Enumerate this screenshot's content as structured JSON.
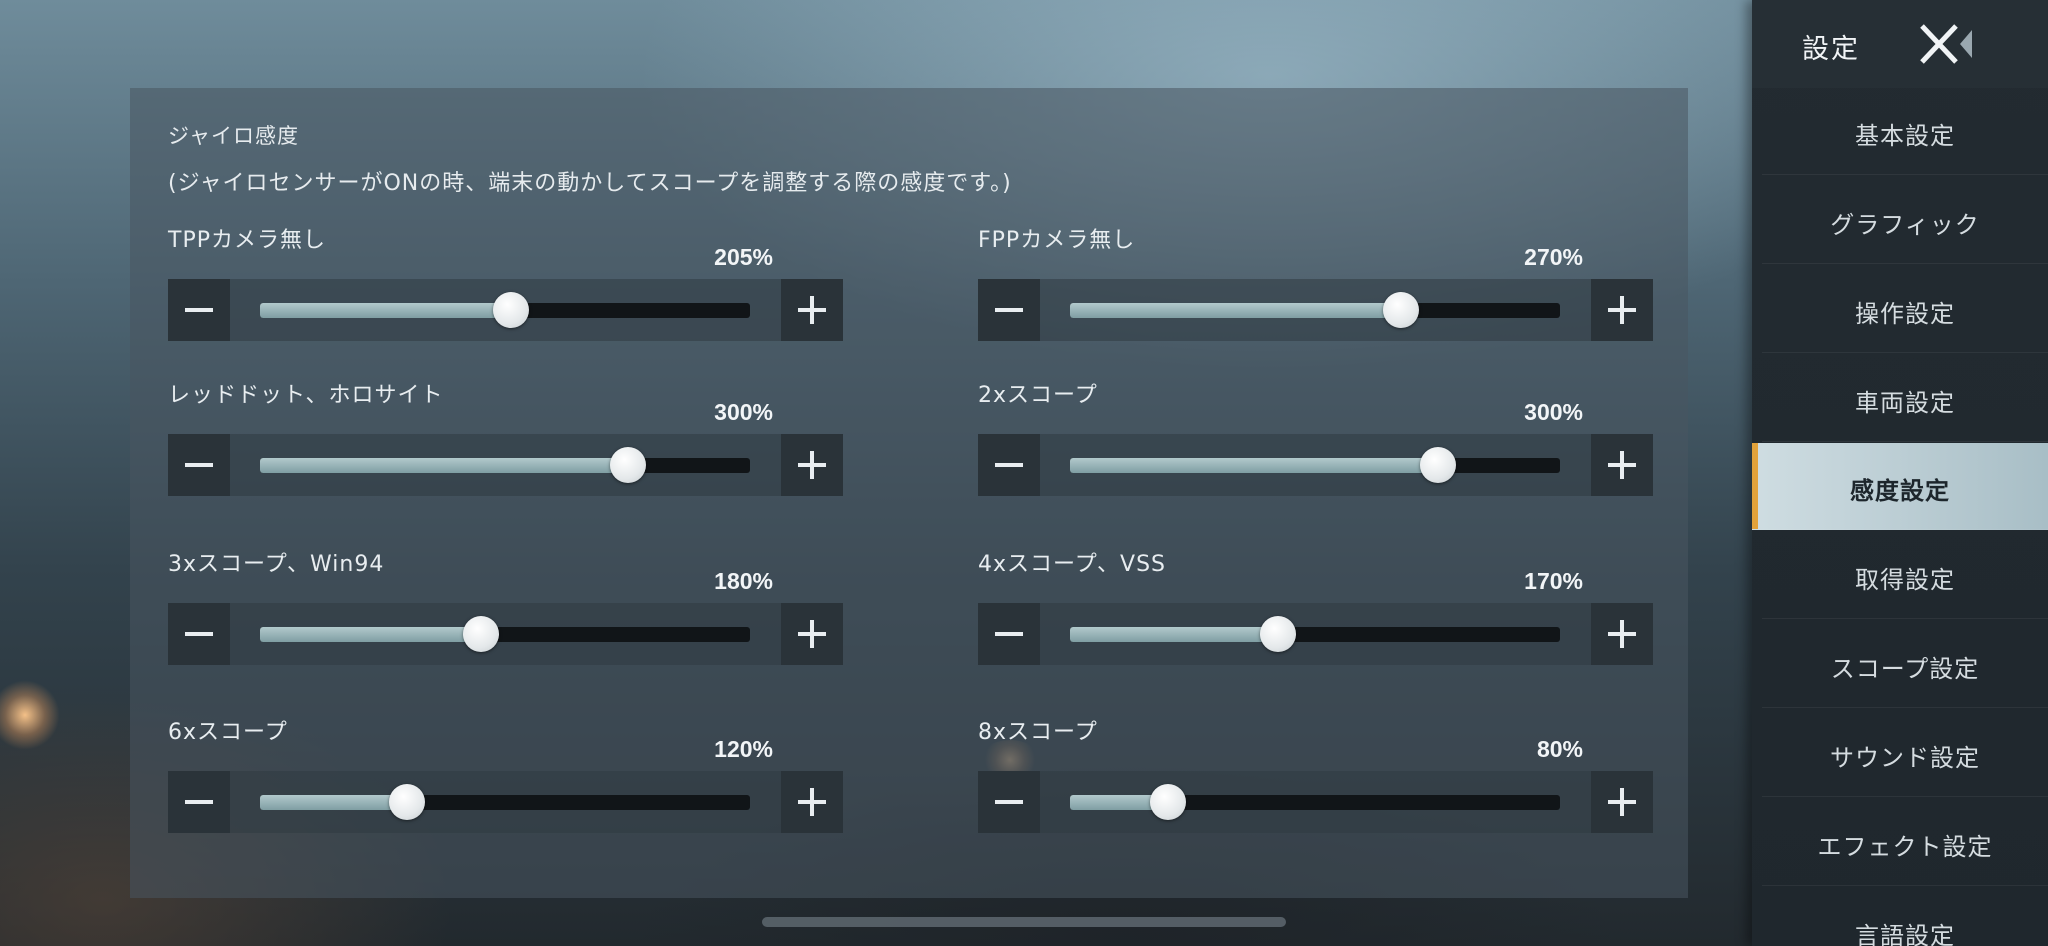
{
  "section": {
    "title": "ジャイロ感度",
    "description": "(ジャイロセンサーがONの時、端末の動かしてスコープを調整する際の感度です。)"
  },
  "sliders": [
    {
      "label": "TPPカメラ無し",
      "value_text": "205%",
      "value": 205,
      "max": 400
    },
    {
      "label": "FPPカメラ無し",
      "value_text": "270%",
      "value": 270,
      "max": 400
    },
    {
      "label": "レッドドット、ホロサイト",
      "value_text": "300%",
      "value": 300,
      "max": 400
    },
    {
      "label": "2xスコープ",
      "value_text": "300%",
      "value": 300,
      "max": 400
    },
    {
      "label": "3xスコープ、Win94",
      "value_text": "180%",
      "value": 180,
      "max": 400
    },
    {
      "label": "4xスコープ、VSS",
      "value_text": "170%",
      "value": 170,
      "max": 400
    },
    {
      "label": "6xスコープ",
      "value_text": "120%",
      "value": 120,
      "max": 400
    },
    {
      "label": "8xスコープ",
      "value_text": "80%",
      "value": 80,
      "max": 400
    }
  ],
  "sidebar": {
    "title": "設定",
    "close_icon": "close-back-icon",
    "items": [
      {
        "label": "基本設定",
        "active": false
      },
      {
        "label": "グラフィック",
        "active": false
      },
      {
        "label": "操作設定",
        "active": false
      },
      {
        "label": "車両設定",
        "active": false
      },
      {
        "label": "感度設定",
        "active": true
      },
      {
        "label": "取得設定",
        "active": false
      },
      {
        "label": "スコープ設定",
        "active": false
      },
      {
        "label": "サウンド設定",
        "active": false
      },
      {
        "label": "エフェクト設定",
        "active": false
      },
      {
        "label": "言語設定",
        "active": false
      }
    ]
  },
  "colors": {
    "accent": "#e2a23a",
    "track_fill": "#8fb0b4",
    "active_tab": "#c3d4da"
  }
}
